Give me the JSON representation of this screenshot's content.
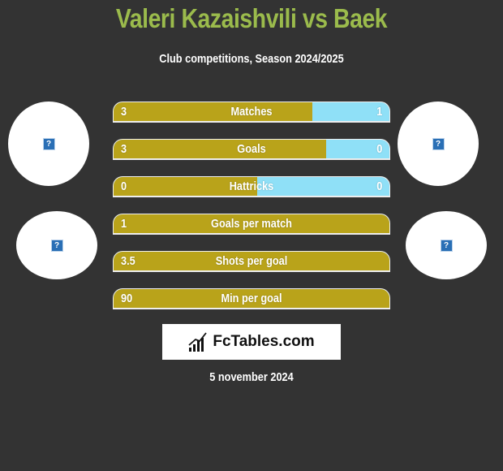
{
  "header": {
    "title": "Valeri Kazaishvili vs Baek",
    "subtitle": "Club competitions, Season 2024/2025"
  },
  "colors": {
    "left_bar": "#b9a31a",
    "right_bar": "#8fe0f7",
    "title": "#9bbb4c",
    "background": "#333333"
  },
  "avatars": {
    "player_left": "unknown-image-icon",
    "club_left": "unknown-image-icon",
    "player_right": "unknown-image-icon",
    "club_right": "unknown-image-icon",
    "glyph": "?"
  },
  "stats": [
    {
      "label": "Matches",
      "left": "3",
      "right": "1",
      "left_share": 0.72
    },
    {
      "label": "Goals",
      "left": "3",
      "right": "0",
      "left_share": 0.77
    },
    {
      "label": "Hattricks",
      "left": "0",
      "right": "0",
      "left_share": 0.52
    },
    {
      "label": "Goals per match",
      "left": "1",
      "right": "",
      "left_share": 1.0
    },
    {
      "label": "Shots per goal",
      "left": "3.5",
      "right": "",
      "left_share": 1.0
    },
    {
      "label": "Min per goal",
      "left": "90",
      "right": "",
      "left_share": 1.0
    }
  ],
  "logo": {
    "text": "FcTables.com",
    "icon": "bar-chart-icon"
  },
  "footer": {
    "date": "5 november 2024"
  }
}
